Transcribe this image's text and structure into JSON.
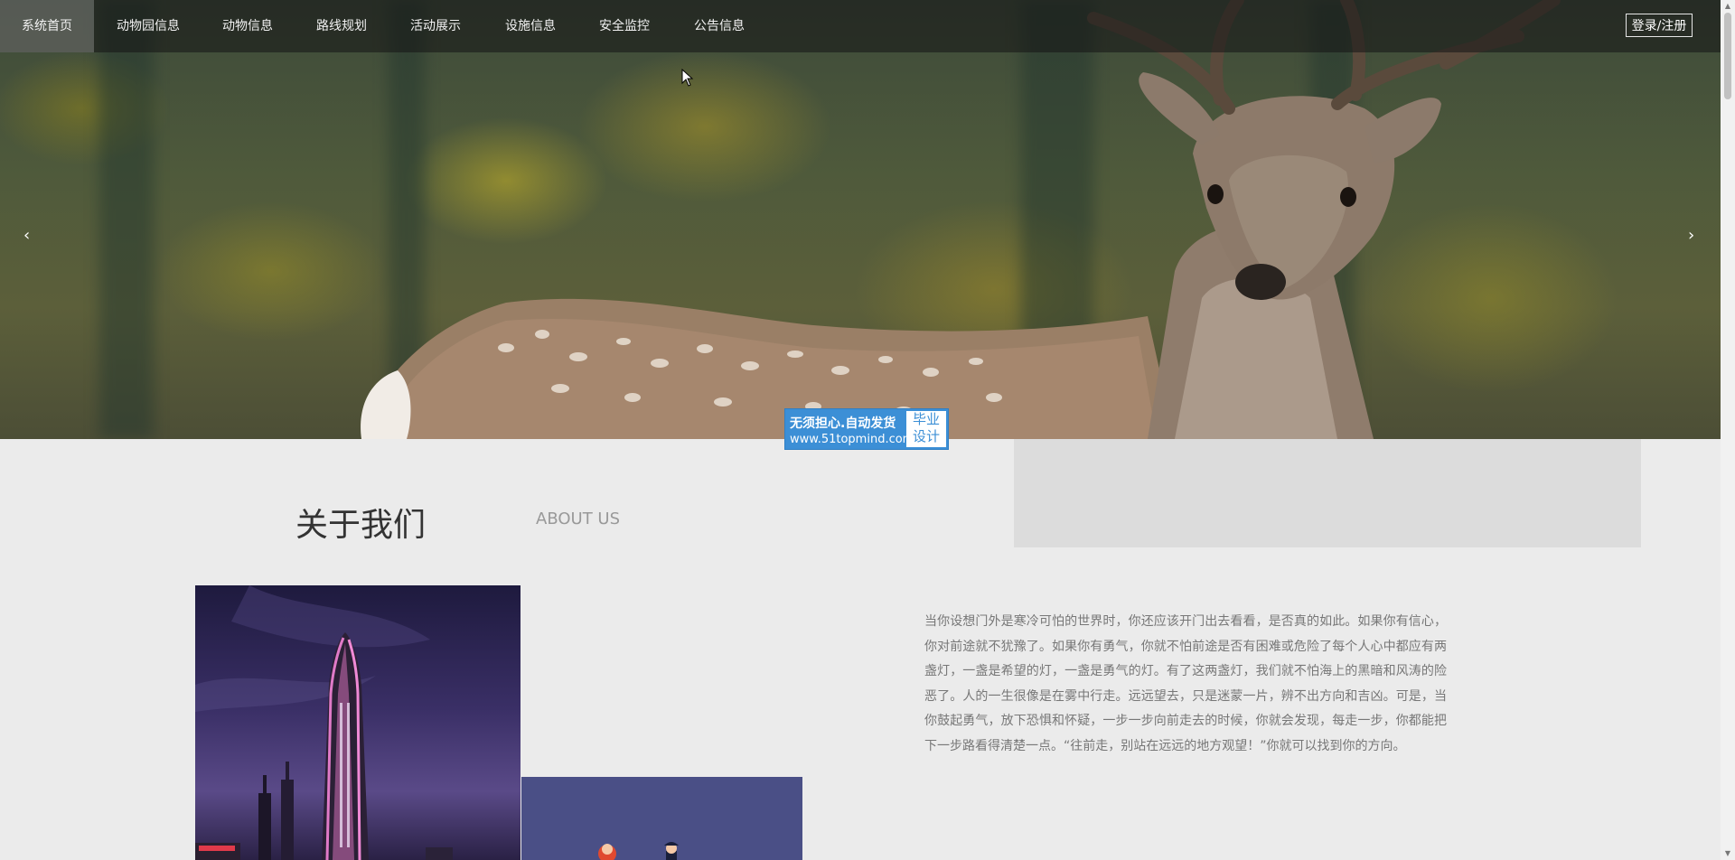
{
  "nav": {
    "items": [
      {
        "label": "系统首页",
        "active": true
      },
      {
        "label": "动物园信息",
        "active": false
      },
      {
        "label": "动物信息",
        "active": false
      },
      {
        "label": "路线规划",
        "active": false
      },
      {
        "label": "活动展示",
        "active": false
      },
      {
        "label": "设施信息",
        "active": false
      },
      {
        "label": "安全监控",
        "active": false
      },
      {
        "label": "公告信息",
        "active": false
      }
    ],
    "login_label": "登录/注册"
  },
  "carousel": {
    "prev_icon": "‹",
    "next_icon": "›"
  },
  "watermark": {
    "main": "无须担心.自动发货",
    "url": "www.51topmind.com",
    "box": "毕业设计"
  },
  "about": {
    "title_cn": "关于我们",
    "title_en": "ABOUT US",
    "text": "当你设想门外是寒冷可怕的世界时，你还应该开门出去看看，是否真的如此。如果你有信心，你对前途就不犹豫了。如果你有勇气，你就不怕前途是否有困难或危险了每个人心中都应有两盏灯，一盏是希望的灯，一盏是勇气的灯。有了这两盏灯，我们就不怕海上的黑暗和风涛的险恶了。人的一生很像是在雾中行走。远远望去，只是迷蒙一片，辨不出方向和吉凶。可是，当你鼓起勇气，放下恐惧和怀疑，一步一步向前走去的时候，你就会发现，每走一步，你都能把下一步路看得清楚一点。“往前走，别站在远远的地方观望！”你就可以找到你的方向。"
  }
}
